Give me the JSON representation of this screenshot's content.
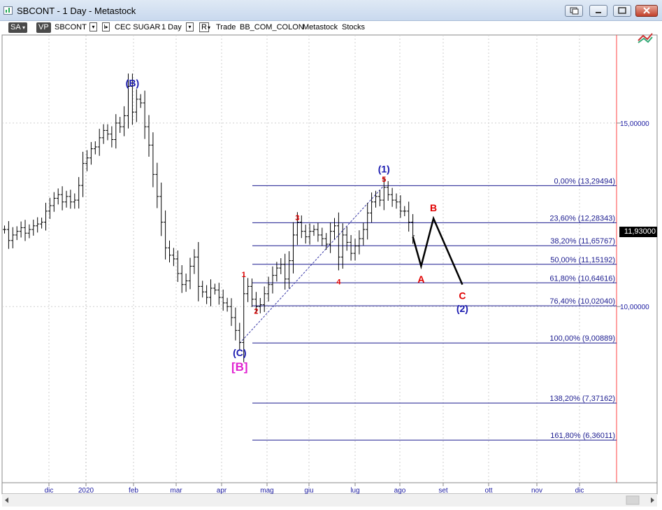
{
  "window": {
    "title": "SBCONT - 1 Day - Metastock",
    "buttons": [
      "restore-down-icon",
      "minimize-icon",
      "maximize-icon",
      "close-icon"
    ]
  },
  "toolbar": {
    "sa_label": "SA",
    "vp_label": "VP",
    "symbol": "SBCONT",
    "instrument": "CEC SUGAR",
    "period": "1 Day",
    "reset_label": "R",
    "trade_label": "Trade",
    "template": "BB_COM_COLON",
    "app_label": "Metastock",
    "stocks_label": "Stocks"
  },
  "colors": {
    "fib_line": "#1b1b8f",
    "red_label": "#e00000",
    "blue_label": "#1a1ab0",
    "magenta_label": "#e020d0",
    "axis_text": "#1a1aa0",
    "grid": "#cfcfcf",
    "vline_red": "#ff4444"
  },
  "chart_data": {
    "type": "ohlc",
    "instrument": "SBCONT",
    "period": "1 Day",
    "y_ticks": [
      15.0,
      10.0
    ],
    "y_tick_labels": [
      "15,00000",
      "10,00000"
    ],
    "ylim": [
      5.2,
      17.4
    ],
    "last_price": "11,93000",
    "x_ticks": [
      "dic",
      "2020",
      "feb",
      "mar",
      "apr",
      "mag",
      "giu",
      "lug",
      "ago",
      "set",
      "ott",
      "nov",
      "dic"
    ],
    "fibonacci": [
      {
        "pct": "0,00%",
        "value": 13.29494,
        "label": "0,00% (13,29494)"
      },
      {
        "pct": "23,60%",
        "value": 12.28343,
        "label": "23,60% (12,28343)"
      },
      {
        "pct": "38,20%",
        "value": 11.65767,
        "label": "38,20% (11,65767)"
      },
      {
        "pct": "50,00%",
        "value": 11.15192,
        "label": "50,00% (11,15192)"
      },
      {
        "pct": "61,80%",
        "value": 10.64616,
        "label": "61,80% (10,64616)"
      },
      {
        "pct": "76,40%",
        "value": 10.0204,
        "label": "76,40% (10,02040)"
      },
      {
        "pct": "100,00%",
        "value": 9.00889,
        "label": "100,00% (9,00889)"
      },
      {
        "pct": "138,20%",
        "value": 7.37162,
        "label": "138,20% (7,37162)"
      },
      {
        "pct": "161,80%",
        "value": 6.36011,
        "label": "161,80% (6,36011)"
      }
    ],
    "wave_labels": [
      {
        "text": "(B)",
        "color": "blue",
        "bar": 31,
        "price": 16.0
      },
      {
        "text": "(C)",
        "color": "blue",
        "bar": 57,
        "price": 8.65
      },
      {
        "text": "[B]",
        "color": "magenta",
        "bar": 57,
        "price": 8.25
      },
      {
        "text": "1",
        "color": "red",
        "bar": 58,
        "price": 10.8
      },
      {
        "text": "2",
        "color": "red",
        "bar": 61,
        "price": 9.8
      },
      {
        "text": "3",
        "color": "red",
        "bar": 71,
        "price": 12.35
      },
      {
        "text": "4",
        "color": "red",
        "bar": 81,
        "price": 10.6
      },
      {
        "text": "5",
        "color": "red",
        "bar": 92,
        "price": 13.4
      },
      {
        "text": "(1)",
        "color": "blue",
        "bar": 92,
        "price": 13.65
      },
      {
        "text": "A",
        "color": "red",
        "bar": 101,
        "price": 10.65
      },
      {
        "text": "B",
        "color": "red",
        "bar": 104,
        "price": 12.6
      },
      {
        "text": "C",
        "color": "red",
        "bar": 111,
        "price": 10.2
      },
      {
        "text": "(2)",
        "color": "blue",
        "bar": 111,
        "price": 9.85
      }
    ],
    "projection_path": [
      {
        "bar": 99,
        "price": 11.9
      },
      {
        "bar": 101,
        "price": 11.1
      },
      {
        "bar": 104,
        "price": 12.4
      },
      {
        "bar": 111,
        "price": 10.6
      }
    ],
    "trendline": [
      {
        "bar": 57,
        "price": 9.0
      },
      {
        "bar": 92,
        "price": 13.3
      }
    ],
    "closes": [
      12.1,
      11.8,
      11.95,
      12.05,
      12.15,
      12.0,
      12.1,
      12.2,
      12.25,
      12.3,
      12.6,
      12.75,
      12.95,
      13.05,
      12.85,
      13.0,
      12.85,
      12.9,
      13.3,
      13.9,
      14.05,
      14.3,
      14.35,
      14.6,
      14.8,
      14.7,
      14.55,
      15.0,
      14.9,
      15.2,
      16.0,
      15.3,
      15.65,
      15.55,
      14.9,
      14.4,
      13.6,
      13.0,
      12.3,
      11.6,
      11.4,
      11.3,
      10.9,
      10.6,
      10.7,
      11.1,
      11.35,
      10.55,
      10.4,
      10.25,
      10.5,
      10.45,
      10.25,
      10.1,
      10.0,
      9.7,
      9.35,
      9.02,
      10.35,
      10.55,
      10.2,
      10.0,
      10.05,
      10.35,
      10.6,
      10.85,
      11.05,
      11.15,
      10.75,
      11.25,
      11.95,
      12.3,
      12.05,
      11.9,
      12.05,
      12.1,
      11.95,
      11.85,
      11.7,
      12.05,
      12.2,
      11.35,
      11.95,
      11.75,
      11.45,
      11.65,
      11.85,
      12.1,
      12.55,
      12.85,
      13.0,
      12.9,
      13.25,
      13.05,
      12.9,
      12.85,
      12.6,
      12.6,
      12.3,
      11.93
    ]
  }
}
